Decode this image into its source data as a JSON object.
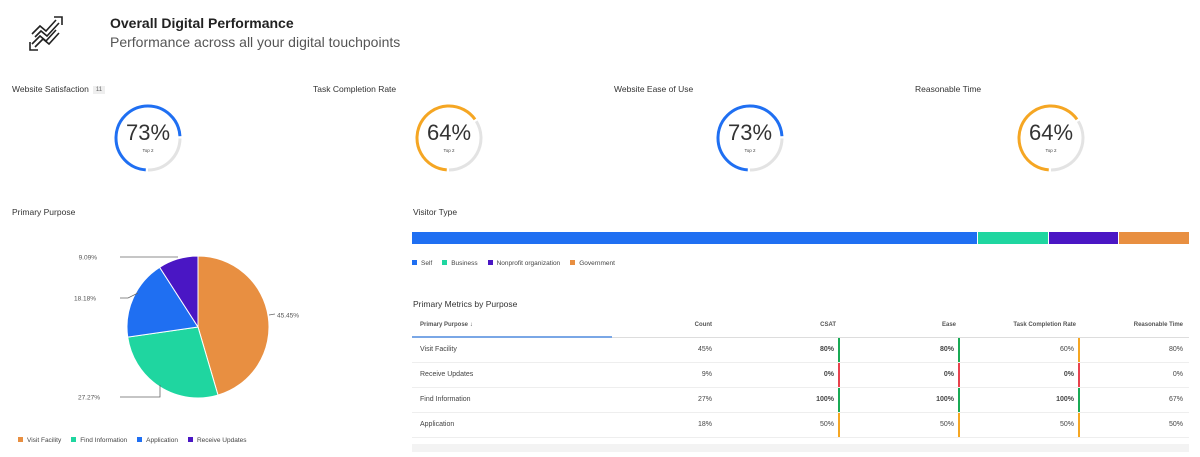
{
  "header": {
    "title": "Overall Digital Performance",
    "subtitle": "Performance across all your digital touchpoints",
    "icon": "trend-arrows-icon"
  },
  "gauges": [
    {
      "title": "Website Satisfaction",
      "badge": "11",
      "value": "73%",
      "fraction": 0.73,
      "label": "Top 2",
      "color": "#1f6ff2"
    },
    {
      "title": "Task Completion Rate",
      "value": "64%",
      "fraction": 0.64,
      "label": "Top 2",
      "color": "#f5a623"
    },
    {
      "title": "Website Ease of Use",
      "value": "73%",
      "fraction": 0.73,
      "label": "Top 2",
      "color": "#1f6ff2"
    },
    {
      "title": "Reasonable Time",
      "value": "64%",
      "fraction": 0.64,
      "label": "Top 2",
      "color": "#f5a623"
    }
  ],
  "primary_purpose": {
    "title": "Primary Purpose"
  },
  "chart_data": [
    {
      "type": "pie",
      "title": "Primary Purpose",
      "categories": [
        "Visit Facility",
        "Find Information",
        "Application",
        "Receive Updates"
      ],
      "values": [
        45.45,
        27.27,
        18.18,
        9.09
      ],
      "labels": [
        "45.45%",
        "27.27%",
        "18.18%",
        "9.09%"
      ],
      "colors": [
        "#e88f41",
        "#1fd6a0",
        "#1f6ff2",
        "#4a16c4"
      ],
      "legend": "bottom"
    },
    {
      "type": "bar",
      "title": "Visitor Type",
      "stacked": true,
      "categories": [
        "Self",
        "Business",
        "Nonprofit organization",
        "Government"
      ],
      "values": [
        72.7,
        9.1,
        9.1,
        9.1
      ],
      "colors": [
        "#1f6ff2",
        "#1fd6a0",
        "#4a16c4",
        "#e88f41"
      ],
      "legend": "bottom"
    }
  ],
  "table": {
    "title": "Primary Metrics by Purpose",
    "headers": [
      "Primary Purpose ↓",
      "Count",
      "CSAT",
      "Ease",
      "Task Completion Rate",
      "Reasonable Time"
    ],
    "rows": [
      {
        "cells": [
          "Visit Facility",
          "45%",
          "80%",
          "80%",
          "60%",
          "80%"
        ],
        "bars": [
          "#1aaa55",
          "#1aaa55",
          "#f5a623"
        ],
        "bold": [
          true,
          true,
          false
        ]
      },
      {
        "cells": [
          "Receive Updates",
          "9%",
          "0%",
          "0%",
          "0%",
          "0%"
        ],
        "bars": [
          "#e8424e",
          "#e8424e",
          "#e8424e"
        ],
        "bold": [
          true,
          true,
          true
        ]
      },
      {
        "cells": [
          "Find Information",
          "27%",
          "100%",
          "100%",
          "100%",
          "67%"
        ],
        "bars": [
          "#1aaa55",
          "#1aaa55",
          "#1aaa55"
        ],
        "bold": [
          true,
          true,
          true
        ]
      },
      {
        "cells": [
          "Application",
          "18%",
          "50%",
          "50%",
          "50%",
          "50%"
        ],
        "bars": [
          "#f5a623",
          "#f5a623",
          "#f5a623"
        ],
        "bold": [
          false,
          false,
          false
        ]
      }
    ]
  }
}
